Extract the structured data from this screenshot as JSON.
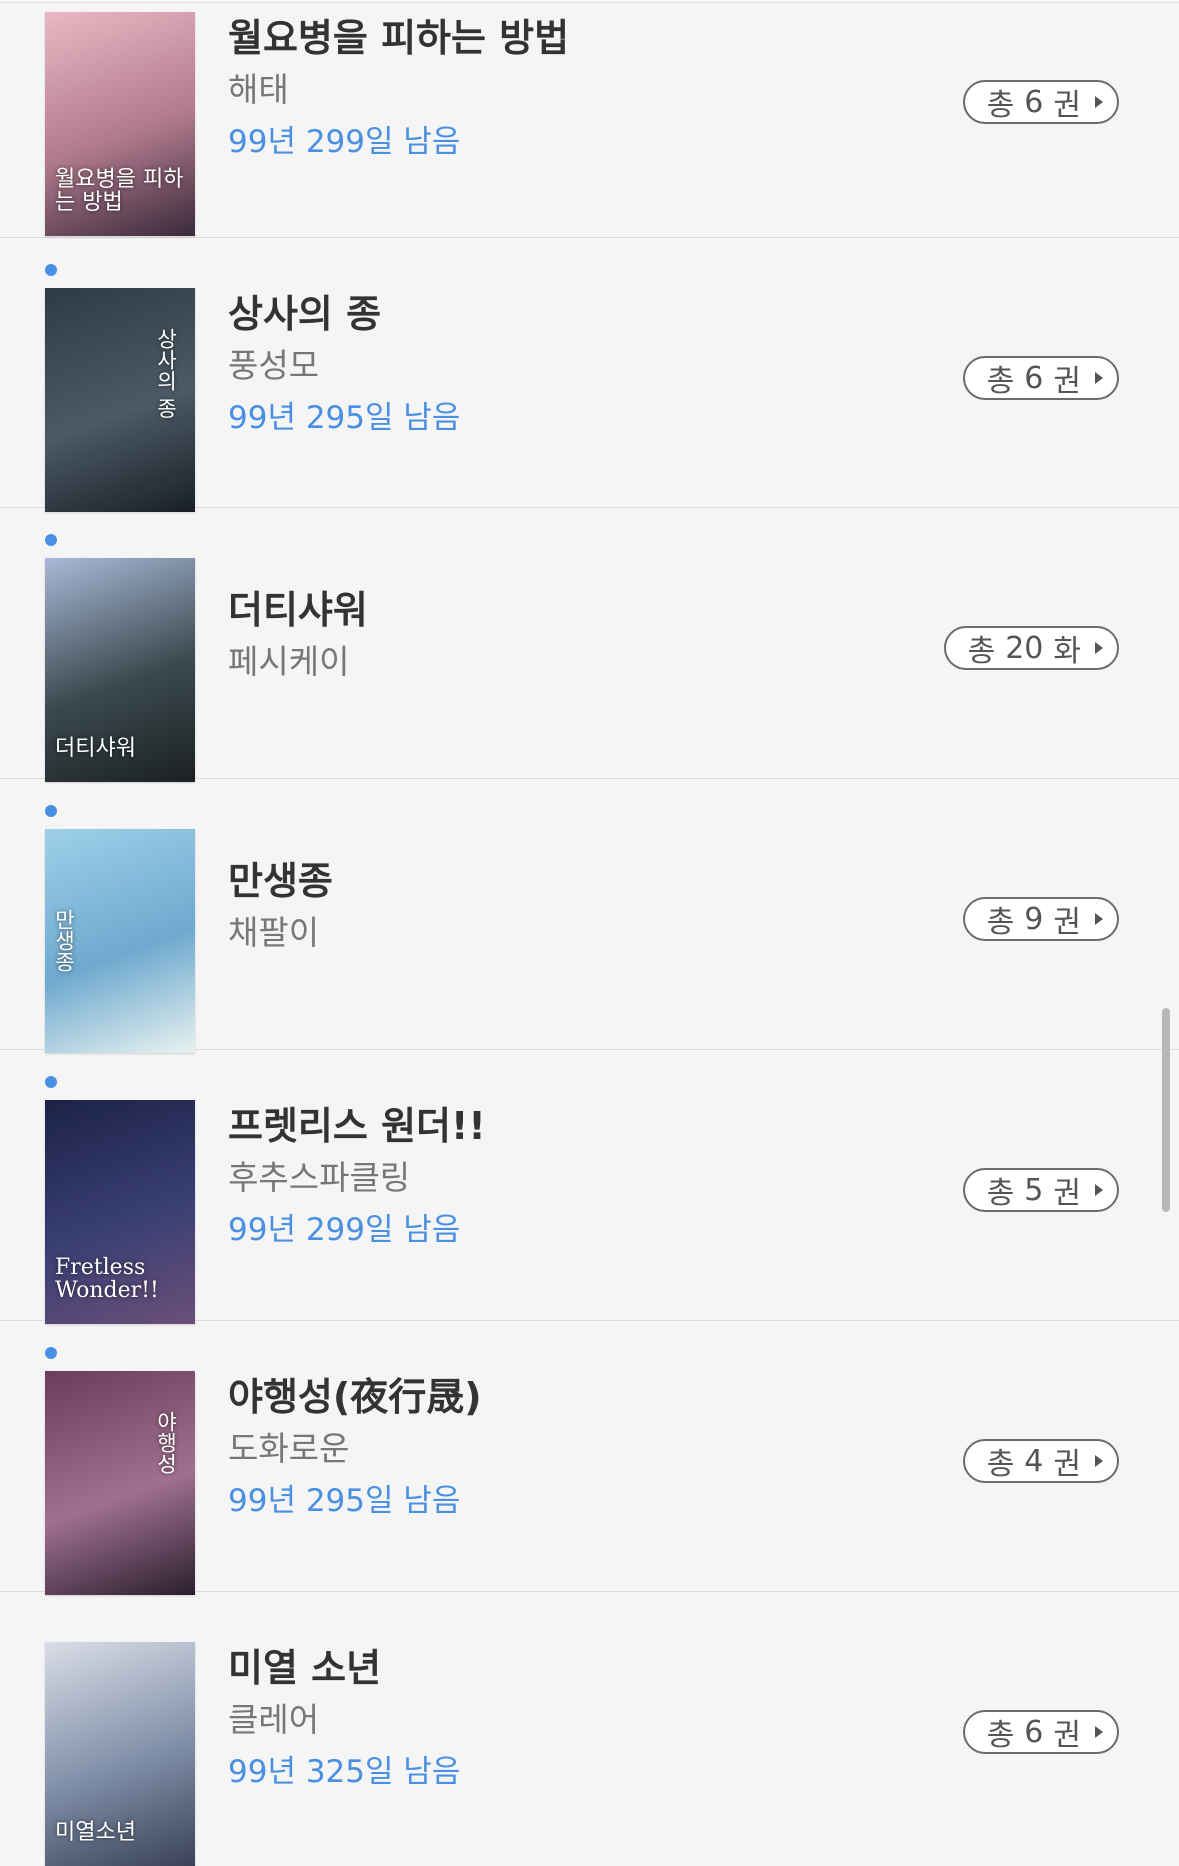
{
  "books": [
    {
      "title": "월요병을 피하는 방법",
      "author": "해태",
      "remaining": "99년 299일 남음",
      "count_prefix": "총",
      "count_num": "6",
      "count_unit": "권",
      "is_new": false,
      "cover_text": "월요병을 피하는 방법",
      "cover_colors": [
        "#e9b8c4",
        "#b07a8d",
        "#3a2a3a"
      ]
    },
    {
      "title": "상사의 종",
      "author": "풍성모",
      "remaining": "99년 295일 남음",
      "count_prefix": "총",
      "count_num": "6",
      "count_unit": "권",
      "is_new": true,
      "cover_text": "상사의 종",
      "cover_colors": [
        "#2e3a48",
        "#4b5a66",
        "#1a1f26"
      ]
    },
    {
      "title": "더티샤워",
      "author": "페시케이",
      "remaining": "",
      "count_prefix": "총",
      "count_num": "20",
      "count_unit": "화",
      "is_new": true,
      "cover_text": "더티샤워",
      "cover_colors": [
        "#a9b9d8",
        "#3b4a4f",
        "#1b2022"
      ]
    },
    {
      "title": "만생종",
      "author": "채팔이",
      "remaining": "",
      "count_prefix": "총",
      "count_num": "9",
      "count_unit": "권",
      "is_new": true,
      "cover_text": "만생종",
      "cover_colors": [
        "#9ed0e8",
        "#6ea9cf",
        "#e8f2f0"
      ]
    },
    {
      "title": "프렛리스 원더!!",
      "author": "후추스파클링",
      "remaining": "99년 299일 남음",
      "count_prefix": "총",
      "count_num": "5",
      "count_unit": "권",
      "is_new": true,
      "cover_text": "Fretless Wonder!!",
      "cover_colors": [
        "#1c2346",
        "#3a3f74",
        "#6a4f78"
      ]
    },
    {
      "title": "야행성(夜行晟)",
      "author": "도화로운",
      "remaining": "99년 295일 남음",
      "count_prefix": "총",
      "count_num": "4",
      "count_unit": "권",
      "is_new": true,
      "cover_text": "야행성",
      "cover_colors": [
        "#6b3d5a",
        "#a07090",
        "#2a1f2e"
      ]
    },
    {
      "title": "미열 소년",
      "author": "클레어",
      "remaining": "99년 325일 남음",
      "count_prefix": "총",
      "count_num": "6",
      "count_unit": "권",
      "is_new": false,
      "cover_text": "미열소년",
      "cover_colors": [
        "#d9dde6",
        "#7f8ea8",
        "#3a4256"
      ]
    }
  ]
}
